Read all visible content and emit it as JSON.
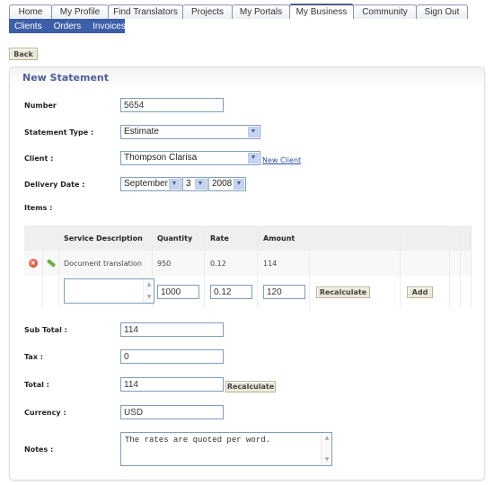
{
  "nav": {
    "tabs": [
      {
        "label": "Home",
        "active": false
      },
      {
        "label": "My Profile",
        "active": false
      },
      {
        "label": "Find Translators",
        "active": false
      },
      {
        "label": "Projects",
        "active": false
      },
      {
        "label": "My Portals",
        "active": false
      },
      {
        "label": "My Business",
        "active": true
      },
      {
        "label": "Community",
        "active": false
      },
      {
        "label": "Sign Out",
        "active": false
      }
    ],
    "subnav": [
      "Clients",
      "Orders",
      "Invoices"
    ]
  },
  "back_label": "Back",
  "form": {
    "title": "New Statement",
    "number_label": "Number",
    "number_value": "5654",
    "statement_type_label": "Statement Type :",
    "statement_type_value": "Estimate",
    "client_label": "Client :",
    "client_value": "Thompson Clarisa",
    "new_client_link": "New Client",
    "delivery_date_label": "Delivery Date :",
    "delivery_month": "September",
    "delivery_day": "3",
    "delivery_year": "2008",
    "items_label": "Items :",
    "items": {
      "headers": [
        "Service Description",
        "Quantity",
        "Rate",
        "Amount"
      ],
      "rows": [
        {
          "description": "Document translation",
          "quantity": "950",
          "rate": "0.12",
          "amount": "114"
        }
      ],
      "new_row": {
        "description": "",
        "quantity": "1000",
        "rate": "0.12",
        "amount": "120",
        "recalculate_label": "Recalculate",
        "add_label": "Add"
      }
    },
    "subtotal_label": "Sub Total :",
    "subtotal_value": "114",
    "tax_label": "Tax :",
    "tax_value": "0",
    "total_label": "Total :",
    "total_value": "114",
    "total_recalculate_label": "Recalculate",
    "currency_label": "Currency :",
    "currency_value": "USD",
    "notes_label": "Notes :",
    "notes_value": "The rates are quoted per word."
  },
  "colors": {
    "subnav_bg": "#3d5ea8",
    "title_color": "#4c5f95",
    "link_color": "#2b4ea0"
  }
}
